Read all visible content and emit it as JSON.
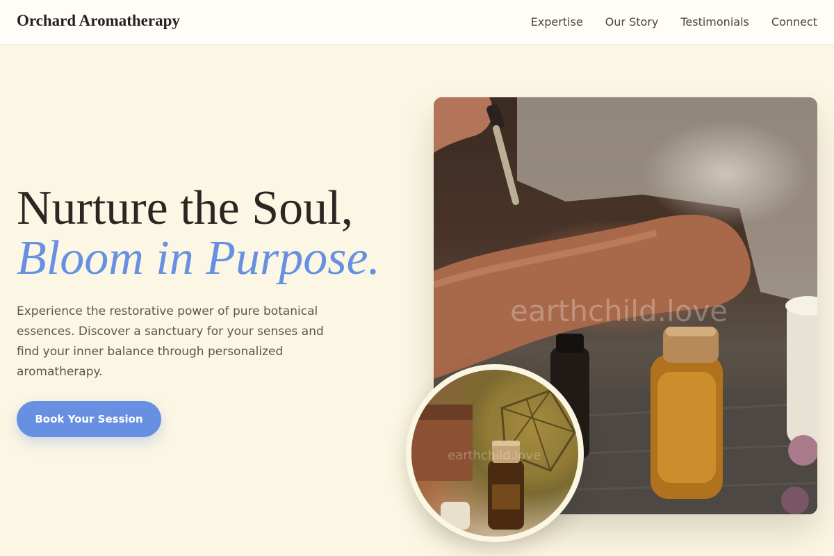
{
  "header": {
    "brand": "Orchard Aromatherapy",
    "nav": [
      "Expertise",
      "Our Story",
      "Testimonials",
      "Connect"
    ]
  },
  "hero": {
    "title_line1": "Nurture the Soul,",
    "title_line2": "Bloom in Purpose.",
    "description": "Experience the restorative power of pure botanical essences. Discover a sanctuary for your senses and find your inner balance through personalized aromatherapy.",
    "cta": "Book Your Session"
  },
  "images": {
    "main_watermark": "earthchild.love",
    "inset_watermark": "earthchild.love"
  },
  "colors": {
    "background": "#fcf7e4",
    "accent": "#6790e2",
    "text": "#2a2622"
  }
}
